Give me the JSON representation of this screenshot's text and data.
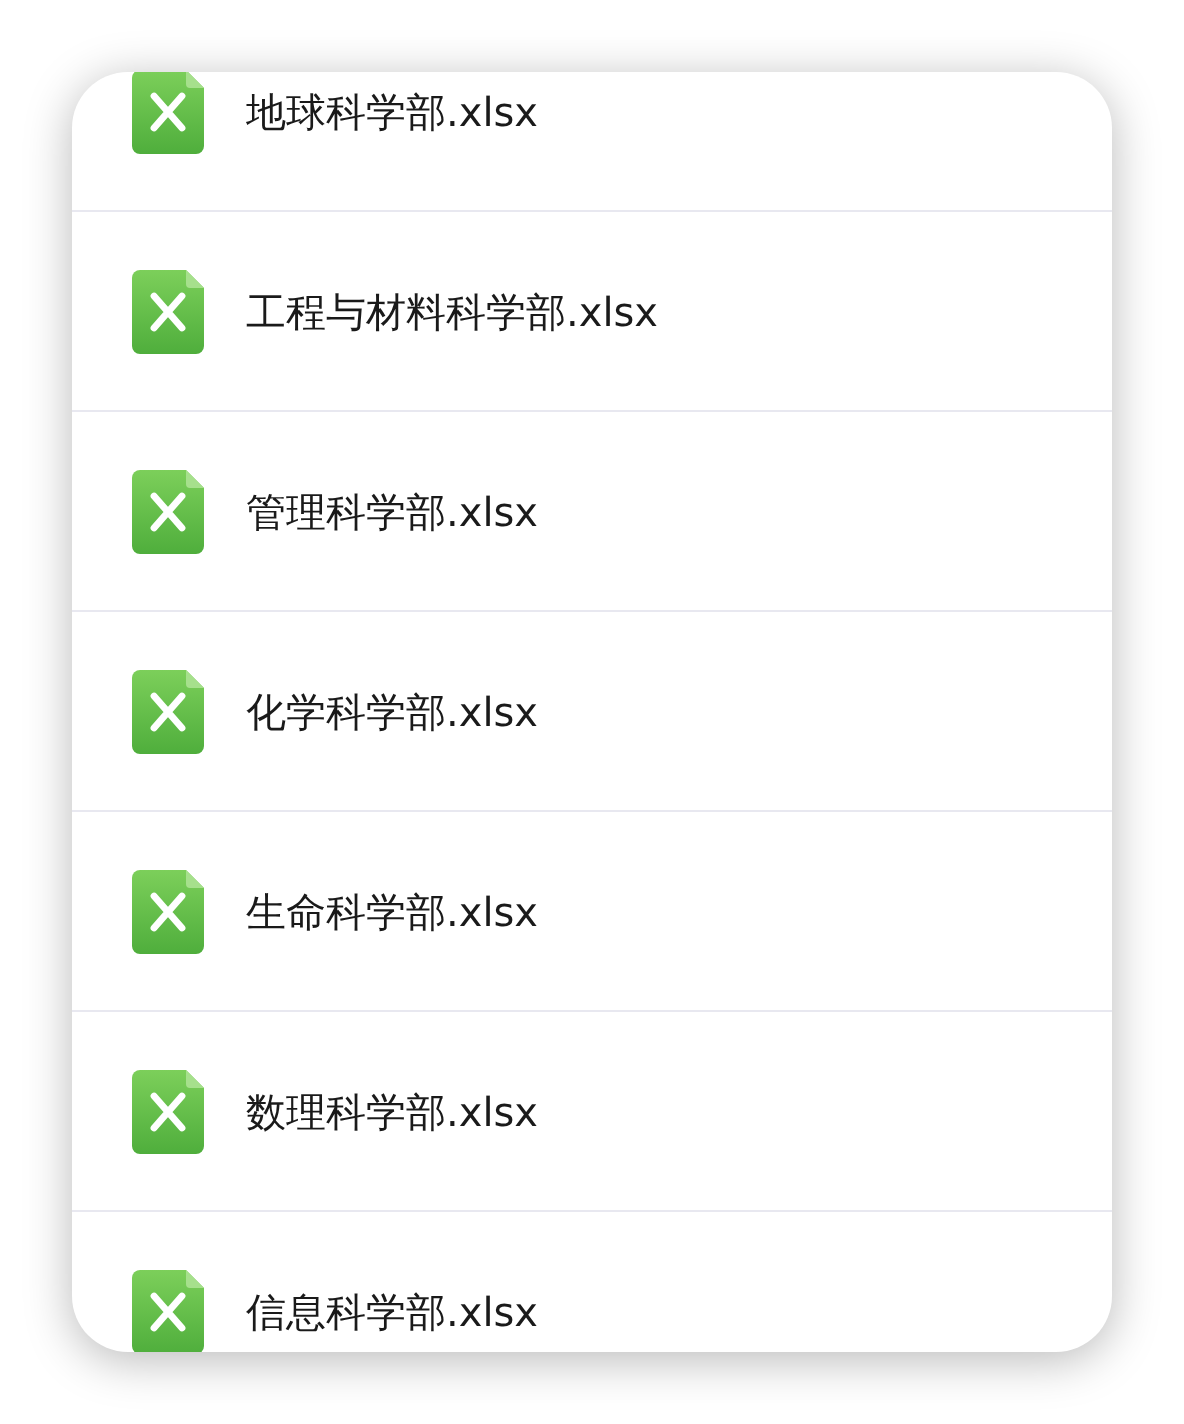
{
  "files": [
    {
      "name": "地球科学部.xlsx"
    },
    {
      "name": "工程与材料科学部.xlsx"
    },
    {
      "name": "管理科学部.xlsx"
    },
    {
      "name": "化学科学部.xlsx"
    },
    {
      "name": "生命科学部.xlsx"
    },
    {
      "name": "数理科学部.xlsx"
    },
    {
      "name": "信息科学部.xlsx"
    }
  ]
}
